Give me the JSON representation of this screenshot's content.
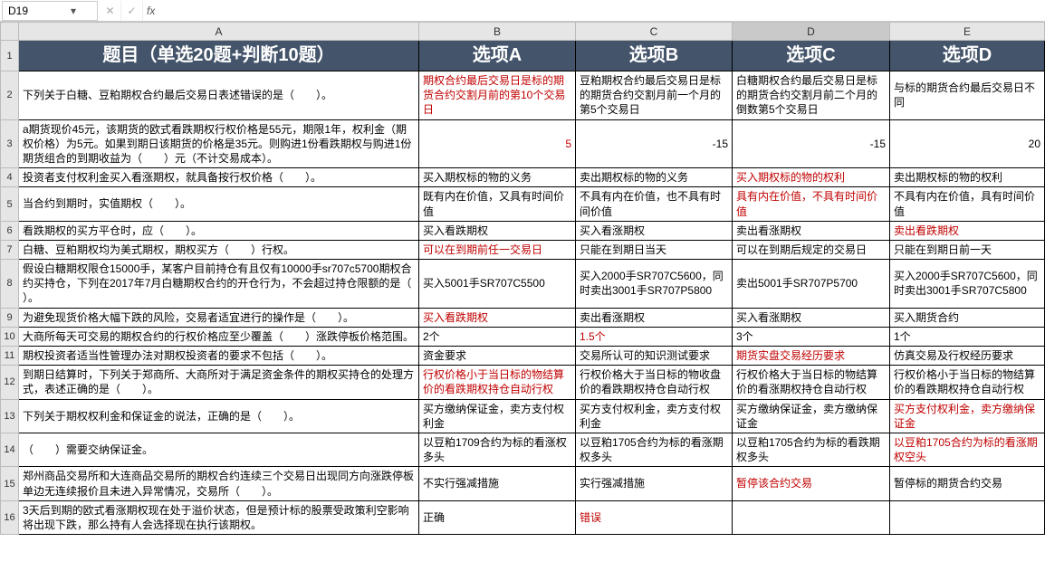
{
  "nameBox": "D19",
  "fxLabel": "fx",
  "formulaValue": "",
  "columns": {
    "A": "A",
    "B": "B",
    "C": "C",
    "D": "D",
    "E": "E"
  },
  "header": {
    "A": "题目（单选20题+判断10题）",
    "B": "选项A",
    "C": "选项B",
    "D": "选项C",
    "E": "选项D"
  },
  "rows": [
    {
      "A": "下列关于白糖、豆粕期权合约最后交易日表述错误的是（　　）。",
      "B": "期权合约最后交易日是标的期货合约交割月前的第10个交易日",
      "C": "豆粕期权合约最后交易日是标的期货合约交割月前一个月的第5个交易日",
      "D": "白糖期权合约最后交易日是标的期货合约交割月前二个月的倒数第5个交易日",
      "E": "与标的期货合约最后交易日不同",
      "red": [
        "B"
      ]
    },
    {
      "A": "a期货现价45元，该期货的欧式看跌期权行权价格是55元，期限1年，权利金（期权价格）为5元。如果到期日该期货的价格是35元。则购进1份看跌期权与购进1份期货组合的到期收益为（　　）元（不计交易成本）。",
      "B": "5",
      "C": "-15",
      "D": "-15",
      "E": "20",
      "num": [
        "B",
        "C",
        "D",
        "E"
      ],
      "red": [
        "B"
      ]
    },
    {
      "A": "投资者支付权利金买入看涨期权，就具备按行权价格（　　）。",
      "B": "买入期权标的物的义务",
      "C": "卖出期权标的物的义务",
      "D": "买入期权标的物的权利",
      "E": "卖出期权标的物的权利",
      "red": [
        "D"
      ]
    },
    {
      "A": "当合约到期时，实值期权（　　）。",
      "B": "既有内在价值，又具有时间价值",
      "C": "不具有内在价值，也不具有时间价值",
      "D": "具有内在价值，不具有时间价值",
      "E": "不具有内在价值，具有时间价值",
      "red": [
        "D"
      ]
    },
    {
      "A": "看跌期权的买方平仓时，应（　　）。",
      "B": "买入看跌期权",
      "C": "买入看涨期权",
      "D": "卖出看涨期权",
      "E": "卖出看跌期权",
      "red": [
        "E"
      ]
    },
    {
      "A": "白糖、豆粕期权均为美式期权，期权买方（　　）行权。",
      "B": "可以在到期前任一交易日",
      "C": "只能在到期日当天",
      "D": "可以在到期后规定的交易日",
      "E": "只能在到期日前一天",
      "red": [
        "B"
      ]
    },
    {
      "A": "假设白糖期权限仓15000手，某客户目前持仓有且仅有10000手sr707c5700期权合约买持仓，下列在2017年7月白糖期权合约的开仓行为，不会超过持仓限额的是（　　）。",
      "B": "买入5001手SR707C5500",
      "C": "买入2000手SR707C5600，同时卖出3001手SR707P5800",
      "D": "卖出5001手SR707P5700",
      "E": "买入2000手SR707C5600，同时卖出3001手SR707C5800",
      "red": []
    },
    {
      "A": "为避免现货价格大幅下跌的风险，交易者适宜进行的操作是（　　）。",
      "B": "买入看跌期权",
      "C": "卖出看涨期权",
      "D": "买入看涨期权",
      "E": "买入期货合约",
      "red": [
        "B"
      ]
    },
    {
      "A": "大商所每天可交易的期权合约的行权价格应至少覆盖（　　）涨跌停板价格范围。",
      "B": "2个",
      "C": "1.5个",
      "D": "3个",
      "E": "1个",
      "red": [
        "C"
      ]
    },
    {
      "A": "期权投资者适当性管理办法对期权投资者的要求不包括（　　）。",
      "B": "资金要求",
      "C": "交易所认可的知识测试要求",
      "D": "期货实盘交易经历要求",
      "E": "仿真交易及行权经历要求",
      "red": [
        "D"
      ]
    },
    {
      "A": "到期日结算时，下列关于郑商所、大商所对于满足资金条件的期权买持仓的处理方式，表述正确的是（　　）。",
      "B": "行权价格小于当日标的物结算价的看跌期权持仓自动行权",
      "C": "行权价格大于当日标的物收盘价的看跌期权持仓自动行权",
      "D": "行权价格大于当日标的物结算价的看涨期权持仓自动行权",
      "E": "行权价格小于当日标的物结算价的看跌期权持仓自动行权",
      "red": [
        "B"
      ]
    },
    {
      "A": "下列关于期权权利金和保证金的说法，正确的是（　　）。",
      "B": "买方缴纳保证金，卖方支付权利金",
      "C": "买方支付权利金，卖方支付权利金",
      "D": "买方缴纳保证金，卖方缴纳保证金",
      "E": "买方支付权利金，卖方缴纳保证金",
      "red": [
        "E"
      ]
    },
    {
      "A": "（　　）需要交纳保证金。",
      "B": "以豆粕1709合约为标的看涨权多头",
      "C": "以豆粕1705合约为标的看涨期权多头",
      "D": "以豆粕1705合约为标的看跌期权多头",
      "E": "以豆粕1705合约为标的看涨期权空头",
      "red": [
        "E"
      ]
    },
    {
      "A": "郑州商品交易所和大连商品交易所的期权合约连续三个交易日出现同方向涨跌停板单边无连续报价且未进入异常情况，交易所（　　）。",
      "B": "不实行强减措施",
      "C": "实行强减措施",
      "D": "暂停该合约交易",
      "E": "暂停标的期货合约交易",
      "red": [
        "D"
      ]
    },
    {
      "A": "3天后到期的欧式看涨期权现在处于溢价状态，但是预计标的股票受政策利空影响将出现下跌，那么持有人会选择现在执行该期权。",
      "B": "正确",
      "C": "错误",
      "D": "",
      "E": "",
      "red": [
        "C"
      ]
    }
  ]
}
